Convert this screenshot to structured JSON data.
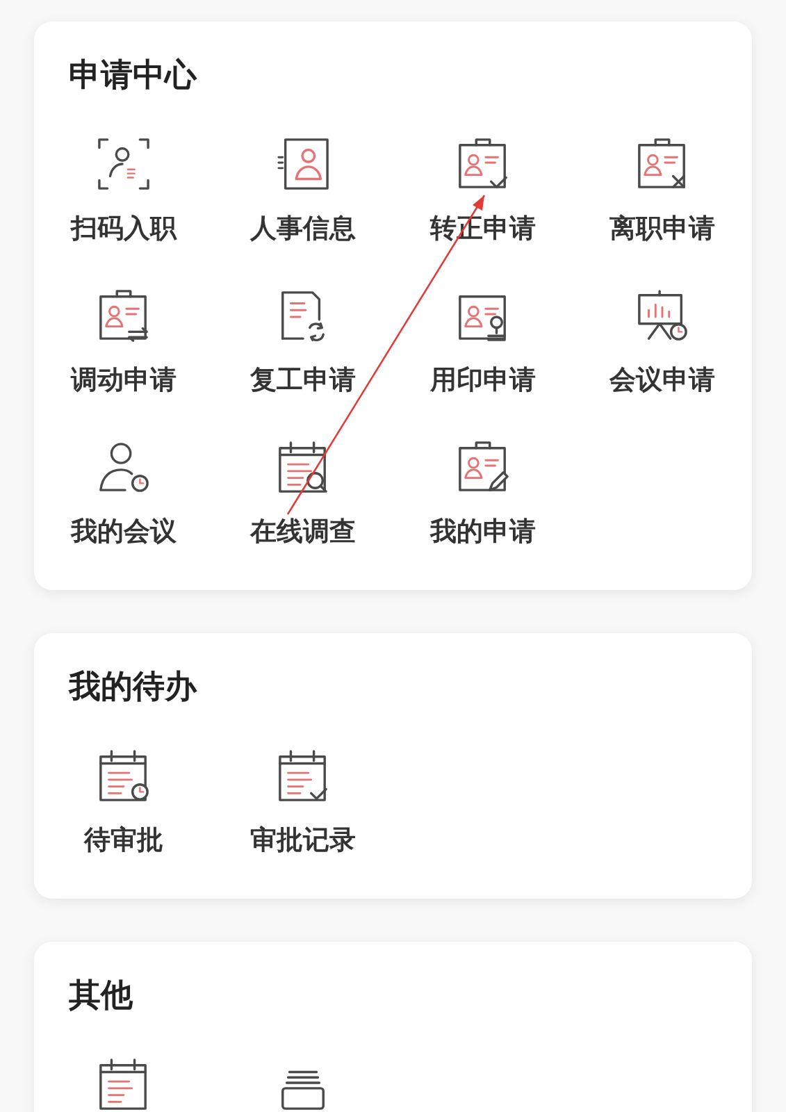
{
  "sections": [
    {
      "title": "申请中心",
      "items": [
        {
          "kind": "tile",
          "label": "扫码入职"
        },
        {
          "kind": "tile",
          "label": "人事信息"
        },
        {
          "kind": "tile",
          "label": "转正申请"
        },
        {
          "kind": "tile",
          "label": "离职申请"
        },
        {
          "kind": "tile",
          "label": "调动申请"
        },
        {
          "kind": "tile",
          "label": "复工申请"
        },
        {
          "kind": "tile",
          "label": "用印申请"
        },
        {
          "kind": "tile",
          "label": "会议申请"
        },
        {
          "kind": "tile",
          "label": "我的会议"
        },
        {
          "kind": "tile",
          "label": "在线调查"
        },
        {
          "kind": "tile",
          "label": "我的申请"
        }
      ]
    },
    {
      "title": "我的待办",
      "items": [
        {
          "kind": "tile",
          "label": "待审批"
        },
        {
          "kind": "tile",
          "label": "审批记录"
        }
      ]
    },
    {
      "title": "其他",
      "items": [
        {
          "kind": "icon-only"
        },
        {
          "kind": "icon-only"
        }
      ]
    }
  ]
}
